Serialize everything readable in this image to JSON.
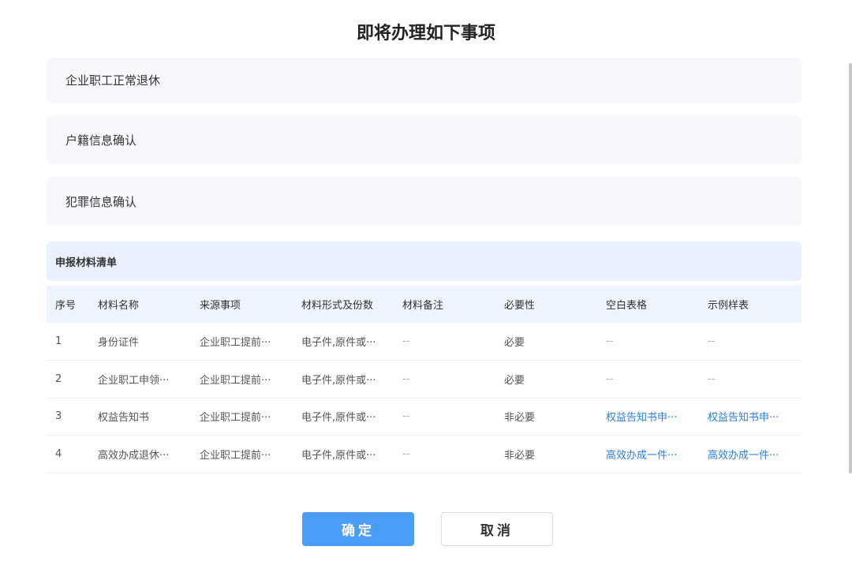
{
  "title": "即将办理如下事项",
  "items": [
    "企业职工正常退休",
    "户籍信息确认",
    "犯罪信息确认"
  ],
  "materials_title": "申报材料清单",
  "table": {
    "headers": [
      "序号",
      "材料名称",
      "来源事项",
      "材料形式及份数",
      "材料备注",
      "必要性",
      "空白表格",
      "示例样表"
    ],
    "rows": [
      [
        "1",
        "身份证件",
        "企业职工提前···",
        "电子件,原件或···",
        "--",
        "必要",
        "--",
        "--"
      ],
      [
        "2",
        "企业职工申领···",
        "企业职工提前···",
        "电子件,原件或···",
        "--",
        "必要",
        "--",
        "--"
      ],
      [
        "3",
        "权益告知书",
        "企业职工提前···",
        "电子件,原件或···",
        "--",
        "非必要",
        "权益告知书申···",
        "权益告知书申···"
      ],
      [
        "4",
        "高效办成退休···",
        "企业职工提前···",
        "电子件,原件或···",
        "--",
        "非必要",
        "高效办成一件···",
        "高效办成一件···"
      ]
    ]
  },
  "buttons": {
    "confirm": "确定",
    "cancel": "取消"
  },
  "colors": {
    "primary": "#4a9ef8",
    "link": "#2b7de9",
    "header_bg": "#e8f1fd"
  }
}
